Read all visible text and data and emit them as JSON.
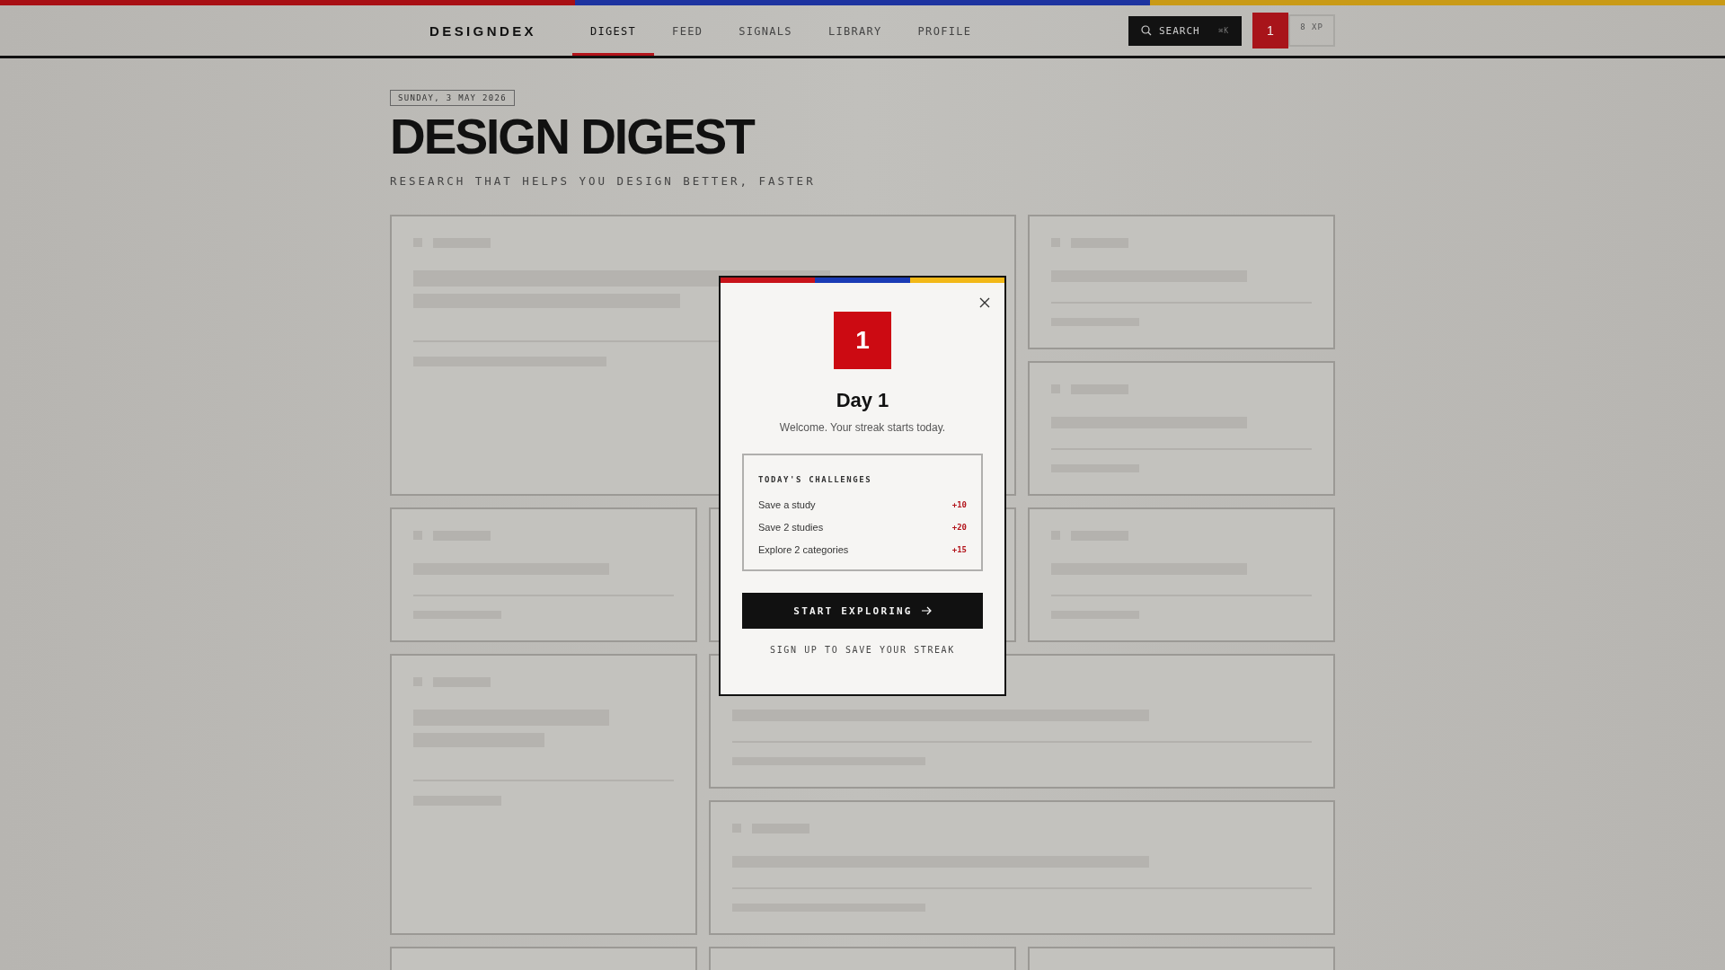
{
  "header": {
    "logo": "DESIGNDEX",
    "tabs": [
      {
        "label": "DIGEST",
        "selected": true
      },
      {
        "label": "FEED",
        "selected": false
      },
      {
        "label": "SIGNALS",
        "selected": false
      },
      {
        "label": "LIBRARY",
        "selected": false
      },
      {
        "label": "PROFILE",
        "selected": false
      }
    ],
    "search": {
      "label": "SEARCH",
      "shortcut": "⌘K"
    },
    "streak": "1",
    "xp": "8 XP"
  },
  "hero": {
    "date": "SUNDAY, 3 MAY 2026",
    "title": "DESIGN DIGEST",
    "subtitle": "RESEARCH THAT HELPS YOU DESIGN BETTER, FASTER"
  },
  "cards": [
    {
      "kind": "feature"
    },
    {
      "kind": "small"
    },
    {
      "kind": "small"
    },
    {
      "kind": "small"
    },
    {
      "kind": "covered"
    },
    {
      "kind": "small"
    },
    {
      "kind": "tall"
    },
    {
      "kind": "wide_cut"
    },
    {
      "kind": "wide"
    },
    {
      "kind": "small"
    },
    {
      "kind": "small"
    },
    {
      "kind": "small"
    }
  ],
  "modal": {
    "badge": "1",
    "title": "Day 1",
    "message": "Welcome. Your streak starts today.",
    "challenges": {
      "heading": "TODAY'S CHALLENGES",
      "items": [
        {
          "label": "Save a study",
          "points": "+10"
        },
        {
          "label": "Save 2 studies",
          "points": "+20"
        },
        {
          "label": "Explore 2 categories",
          "points": "+15"
        }
      ]
    },
    "primary_button": "START EXPLORING",
    "secondary_link": "SIGN UP TO SAVE YOUR STREAK"
  }
}
